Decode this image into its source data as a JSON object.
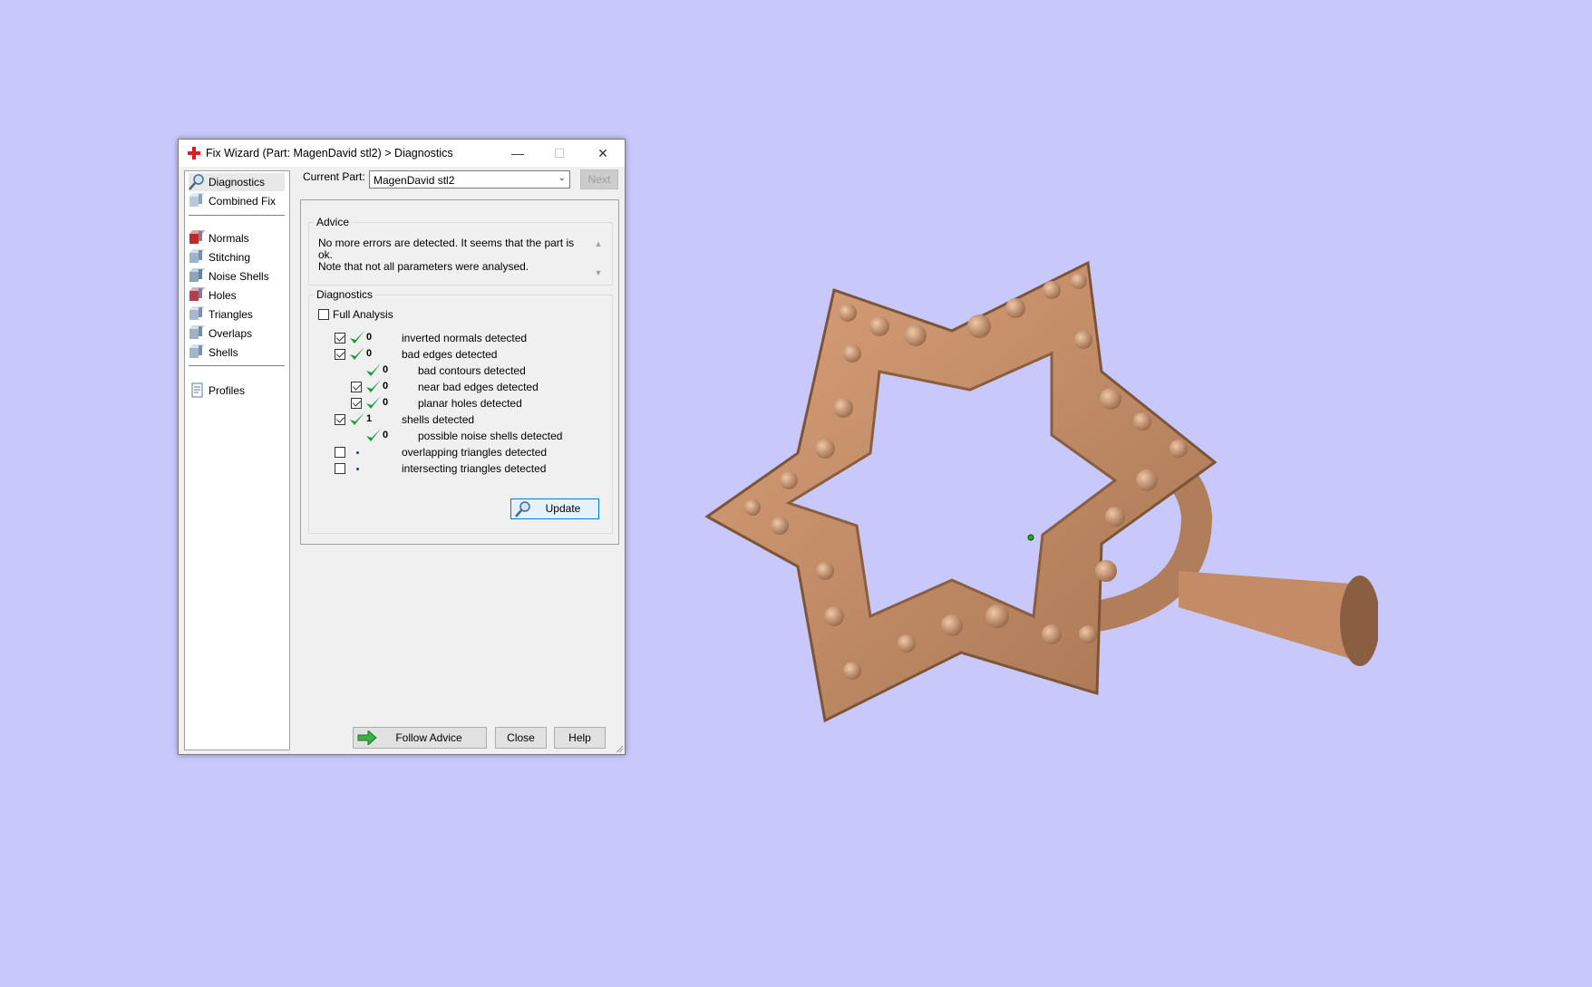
{
  "window": {
    "title": "Fix Wizard (Part: MagenDavid stl2) > Diagnostics",
    "minimize_glyph": "—",
    "maximize_glyph": "☐",
    "close_glyph": "✕"
  },
  "nav": {
    "top_items": [
      {
        "label": "Diagnostics",
        "icon": "magnifier-icon",
        "selected": true
      },
      {
        "label": "Combined Fix",
        "icon": "cube-icon"
      }
    ],
    "tool_items": [
      {
        "label": "Normals",
        "icon": "normals-cube-icon"
      },
      {
        "label": "Stitching",
        "icon": "stitching-cube-icon"
      },
      {
        "label": "Noise Shells",
        "icon": "noise-shells-icon"
      },
      {
        "label": "Holes",
        "icon": "holes-cube-icon"
      },
      {
        "label": "Triangles",
        "icon": "triangles-cube-icon"
      },
      {
        "label": "Overlaps",
        "icon": "overlaps-cube-icon"
      },
      {
        "label": "Shells",
        "icon": "shells-cube-icon"
      }
    ],
    "bottom_items": [
      {
        "label": "Profiles",
        "icon": "profiles-icon"
      }
    ]
  },
  "header": {
    "current_part_label": "Current Part:",
    "current_part_value": "MagenDavid stl2",
    "next_label": "Next"
  },
  "advice": {
    "title": "Advice",
    "line1": "No more errors are detected. It seems that the part is ok.",
    "line2": "Note that not all parameters were analysed."
  },
  "diagnostics": {
    "title": "Diagnostics",
    "full_analysis_label": "Full Analysis",
    "full_analysis_checked": false,
    "rows": [
      {
        "checkbox": true,
        "checked": true,
        "status": "ok",
        "count": "0",
        "label": "inverted normals detected",
        "indent": 0
      },
      {
        "checkbox": true,
        "checked": true,
        "status": "ok",
        "count": "0",
        "label": "bad edges detected",
        "indent": 0
      },
      {
        "checkbox": false,
        "checked": false,
        "status": "ok",
        "count": "0",
        "label": "bad contours detected",
        "indent": 1
      },
      {
        "checkbox": true,
        "checked": true,
        "status": "ok",
        "count": "0",
        "label": "near bad edges detected",
        "indent": 1
      },
      {
        "checkbox": true,
        "checked": true,
        "status": "ok",
        "count": "0",
        "label": "planar holes detected",
        "indent": 1
      },
      {
        "checkbox": true,
        "checked": true,
        "status": "ok",
        "count": "1",
        "label": "shells detected",
        "indent": 0
      },
      {
        "checkbox": false,
        "checked": false,
        "status": "ok",
        "count": "0",
        "label": "possible noise shells detected",
        "indent": 1
      },
      {
        "checkbox": true,
        "checked": false,
        "status": "none",
        "count": "",
        "label": "overlapping triangles detected",
        "indent": 0
      },
      {
        "checkbox": true,
        "checked": false,
        "status": "none",
        "count": "",
        "label": "intersecting triangles detected",
        "indent": 0
      }
    ],
    "update_label": "Update"
  },
  "footer": {
    "follow_advice_label": "Follow Advice",
    "close_label": "Close",
    "help_label": "Help"
  },
  "colors": {
    "background": "#c8c8fa",
    "model": "#c8906a",
    "tick_green": "#1f9a3a"
  }
}
